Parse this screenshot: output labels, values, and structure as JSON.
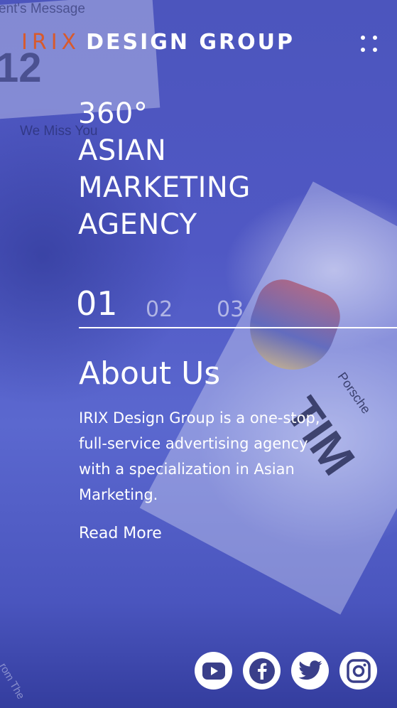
{
  "background": {
    "text_1": "ent's Message",
    "text_2": "12",
    "text_3": "We Miss You",
    "text_4": "TIM",
    "text_5": "Porsche",
    "text_6": "rom The"
  },
  "header": {
    "logo_accent": "IRIX",
    "logo_rest": "DESIGN GROUP",
    "menu_icon": "dots-grid-icon"
  },
  "hero": {
    "lines": [
      "360°",
      "ASIAN",
      "MARKETING",
      "AGENCY"
    ]
  },
  "slider": {
    "items": [
      "01",
      "02",
      "03"
    ],
    "active_index": 0
  },
  "about": {
    "title": "About Us",
    "body": "IRIX Design Group is a one-stop, full-service advertising agency with a specialization in Asian Marketing.",
    "link": "Read More"
  },
  "social": {
    "icons": [
      "youtube-icon",
      "facebook-icon",
      "twitter-icon",
      "instagram-icon"
    ]
  },
  "colors": {
    "accent": "#d85a2c",
    "overlay": "#4a55c0",
    "text": "#ffffff"
  }
}
